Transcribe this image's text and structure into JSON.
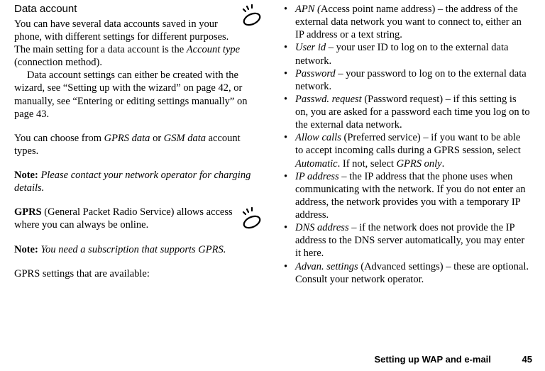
{
  "left": {
    "heading": "Data account",
    "p1a": "You can have several data accounts saved in your phone, with different settings for different purposes. The main setting for a data account is the ",
    "p1b": "Account type",
    "p1c": " (connection method).",
    "p2": "Data account settings can either be created with the wizard, see “Setting up with the wizard” on page 42, or manually, see “Entering or editing settings manually” on page 43.",
    "p3a": "You can choose from ",
    "p3b": "GPRS data",
    "p3c": " or ",
    "p3d": "GSM data",
    "p3e": " account types.",
    "note1a": "Note:",
    "note1b": " Please contact your network operator for charging details.",
    "gprs_a": "GPRS",
    "gprs_b": " (General Packet Radio Service) allows access where you can always be online.",
    "note2a": "Note:",
    "note2b": " You need a subscription that supports GPRS.",
    "p4": "GPRS settings that are available:"
  },
  "right": {
    "items": [
      {
        "term": "APN (",
        "termrest": "Access point name address) – the address of the external data network you want to connect to, either an IP address or a text string."
      },
      {
        "term": "User id",
        "termrest": " – your user ID to log on to the external data network."
      },
      {
        "term": "Password",
        "termrest": " – your password to log on to the external data network."
      },
      {
        "term": "Passwd. request",
        "termrest": " (Password request) – if this setting is on, you are asked for a password each time you log on to the external data network."
      },
      {
        "term": "Allow calls",
        "termrest_a": " (Preferred service) – if you want to be able to accept incoming calls during a GPRS session, select ",
        "mid1": "Automatic",
        "termrest_b": ". If not, select ",
        "mid2": "GPRS only",
        "termrest_c": "."
      },
      {
        "term": "IP address",
        "termrest": " – the IP address that the phone uses when communicating with the network. If you do not enter an address, the network provides you with a temporary IP address."
      },
      {
        "term": "DNS address",
        "termrest": " – if the network does not provide the IP address to the DNS server automatically, you may enter it here."
      },
      {
        "term": "Advan. settings",
        "termrest": " (Advanced settings) – these are optional. Consult your network operator."
      }
    ]
  },
  "footer": {
    "section": "Setting up WAP and e-mail",
    "page": "45"
  }
}
